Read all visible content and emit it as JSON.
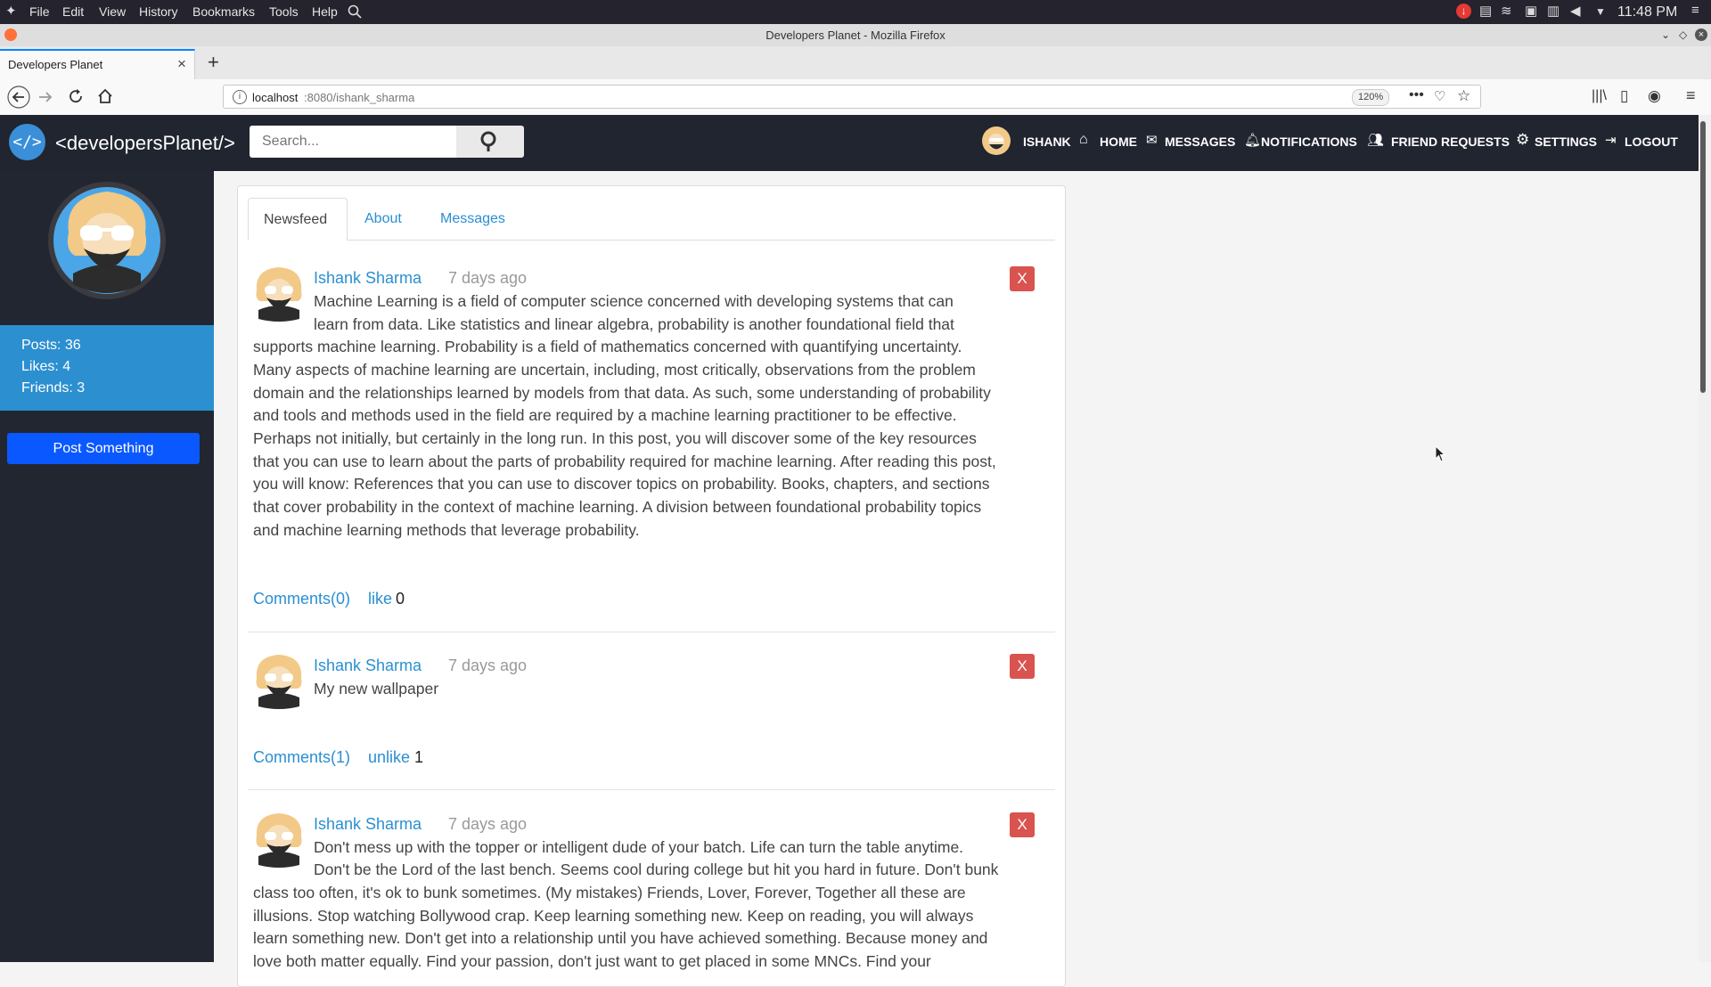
{
  "os": {
    "menus": [
      "File",
      "Edit",
      "View",
      "History",
      "Bookmarks",
      "Tools",
      "Help"
    ],
    "clock": "11:48 PM"
  },
  "browser": {
    "window_title": "Developers Planet - Mozilla Firefox",
    "tab_title": "Developers Planet",
    "url_host": "localhost",
    "url_path": ":8080/ishank_sharma",
    "zoom": "120%"
  },
  "site": {
    "brand": "<developersPlanet/>",
    "search_placeholder": "Search...",
    "nav": {
      "user": "ISHANK",
      "home": "HOME",
      "messages": "MESSAGES",
      "notifications": "NOTIFICATIONS",
      "friend_requests": "FRIEND REQUESTS",
      "settings": "SETTINGS",
      "logout": "LOGOUT"
    }
  },
  "sidebar": {
    "posts": "Posts: 36",
    "likes": "Likes: 4",
    "friends": "Friends: 3",
    "post_button": "Post Something"
  },
  "tabs": [
    "Newsfeed",
    "About",
    "Messages"
  ],
  "posts": [
    {
      "author": "Ishank Sharma",
      "time": "7 days ago",
      "delete": "X",
      "lines": [
        "Machine Learning is a field of computer science concerned with developing systems that can",
        "learn from data. Like statistics and linear algebra, probability is another foundational field that",
        "supports machine learning. Probability is a field of mathematics concerned with quantifying uncertainty.",
        "Many aspects of machine learning are uncertain, including, most critically, observations from the problem",
        "domain and the relationships learned by models from that data. As such, some understanding of probability",
        "and tools and methods used in the field are required by a machine learning practitioner to be effective.",
        "Perhaps not initially, but certainly in the long run. In this post, you will discover some of the key resources",
        "that you can use to learn about the parts of probability required for machine learning. After reading this post,",
        "you will know: References that you can use to discover topics on probability. Books, chapters, and sections",
        "that cover probability in the context of machine learning. A division between foundational probability topics",
        "and machine learning methods that leverage probability."
      ],
      "comments": "Comments(0)",
      "like_label": "like",
      "like_count": "0"
    },
    {
      "author": "Ishank Sharma",
      "time": "7 days ago",
      "delete": "X",
      "lines": [
        "My new wallpaper"
      ],
      "comments": "Comments(1)",
      "like_label": "unlike",
      "like_count": "1"
    },
    {
      "author": "Ishank Sharma",
      "time": "7 days ago",
      "delete": "X",
      "lines": [
        "Don't mess up with the topper or intelligent dude of your batch. Life can turn the table anytime.",
        "Don't be the Lord of the last bench. Seems cool during college but hit you hard in future. Don't bunk",
        "class too often, it's ok to bunk sometimes. (My mistakes) Friends, Lover, Forever, Together all these are",
        "illusions. Stop watching Bollywood crap. Keep learning something new. Keep on reading, you will always",
        "learn something new. Don't get into a relationship until you have achieved something. Because money and",
        "love both matter equally. Find your passion, don't just want to get placed in some MNCs. Find your"
      ]
    }
  ]
}
